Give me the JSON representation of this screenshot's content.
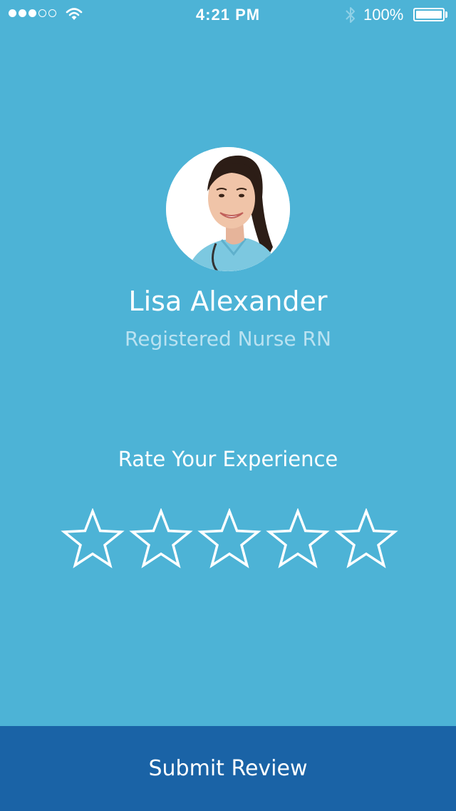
{
  "status_bar": {
    "signal_filled": 3,
    "signal_total": 5,
    "time": "4:21 PM",
    "battery_text": "100%",
    "battery_level": 1.0
  },
  "profile": {
    "name": "Lisa Alexander",
    "title": "Registered Nurse RN"
  },
  "rating": {
    "label": "Rate Your Experience",
    "max_stars": 5,
    "selected": 0
  },
  "submit_button": {
    "label": "Submit Review"
  },
  "colors": {
    "background": "#4db3d6",
    "submit_bar": "#1a63a6",
    "subtitle": "#b9e2f1",
    "foreground": "#ffffff"
  },
  "icons": {
    "wifi": "wifi-icon",
    "bluetooth": "bluetooth-icon",
    "battery": "battery-icon",
    "star": "star-outline-icon"
  }
}
